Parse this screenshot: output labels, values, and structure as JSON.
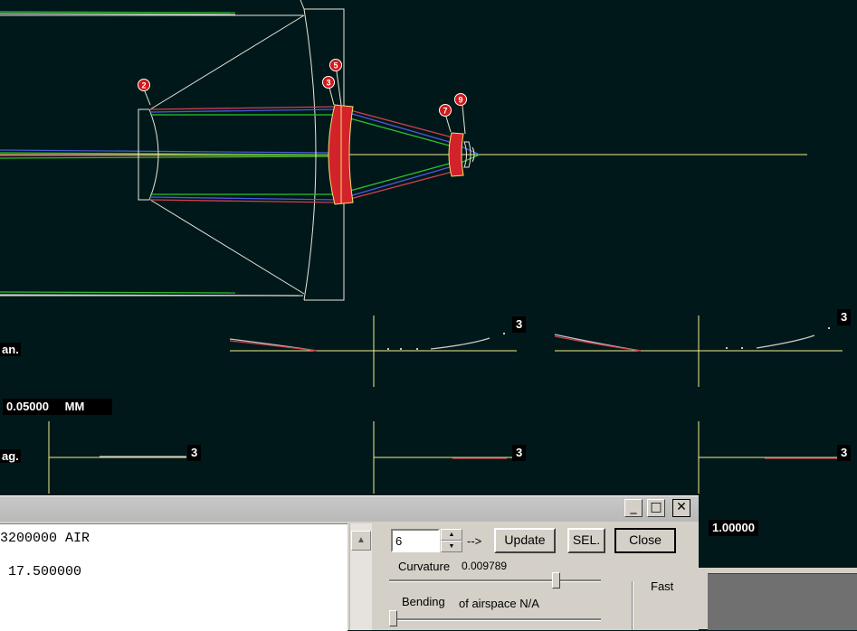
{
  "surface_labels": [
    "2",
    "3",
    "5",
    "7",
    "9"
  ],
  "plot": {
    "tan_label": "an.",
    "sag_label": "ag.",
    "scale_value": "0.05000",
    "scale_unit": "MM",
    "field_number": "3",
    "zoom_value": "1.00000"
  },
  "colors": {
    "background": "#01181a",
    "axis": "#f0f08c",
    "lens_fill": "#d2232a",
    "ray_green": "#2bc22b",
    "ray_blue": "#4a5be0",
    "ray_red": "#d04050",
    "ray_gray": "#c8c8c8"
  },
  "dialog": {
    "text_lines": [
      "3200000 AIR",
      " 17.500000"
    ],
    "surface_value": "6",
    "arrow_text": "-->",
    "update_label": "Update",
    "sel_label": "SEL.",
    "close_label": "Close",
    "curvature_label": "Curvature",
    "curvature_value": "0.009789",
    "curvature_level": 0.8,
    "bending_label": "Bending",
    "bending_value": "of airspace N/A",
    "bending_level": 0.0,
    "fast_label": "Fast",
    "minimize_glyph": "_",
    "maximize_glyph": "□",
    "close_glyph": "✕"
  }
}
